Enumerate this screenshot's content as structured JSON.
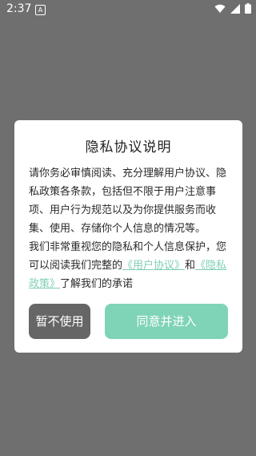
{
  "status_bar": {
    "time": "2:37",
    "notification_letter": "A",
    "icons": [
      "wifi-icon",
      "signal-icon",
      "battery-icon"
    ]
  },
  "dialog": {
    "title": "隐私协议说明",
    "paragraph1": "请你务必审慎阅读、充分理解用户协议、隐私政策各条款，包括但不限于用户注意事项、用户行为规范以及为你提供服务而收集、使用、存储你个人信息的情况等。",
    "paragraph2_prefix": "我们非常重视您的隐私和个人信息保护，您可以阅读我们完整的",
    "user_agreement_link": "《用户协议》",
    "and_text": "和",
    "privacy_policy_link": "《隐私政策》",
    "paragraph2_suffix": "了解我们的承诺",
    "decline_button": "暂不使用",
    "agree_button": "同意并进入"
  },
  "colors": {
    "backdrop": "#6f6f6f",
    "link": "#7fcfb4",
    "agree_button": "#7fd3b6",
    "decline_button": "#666666"
  }
}
